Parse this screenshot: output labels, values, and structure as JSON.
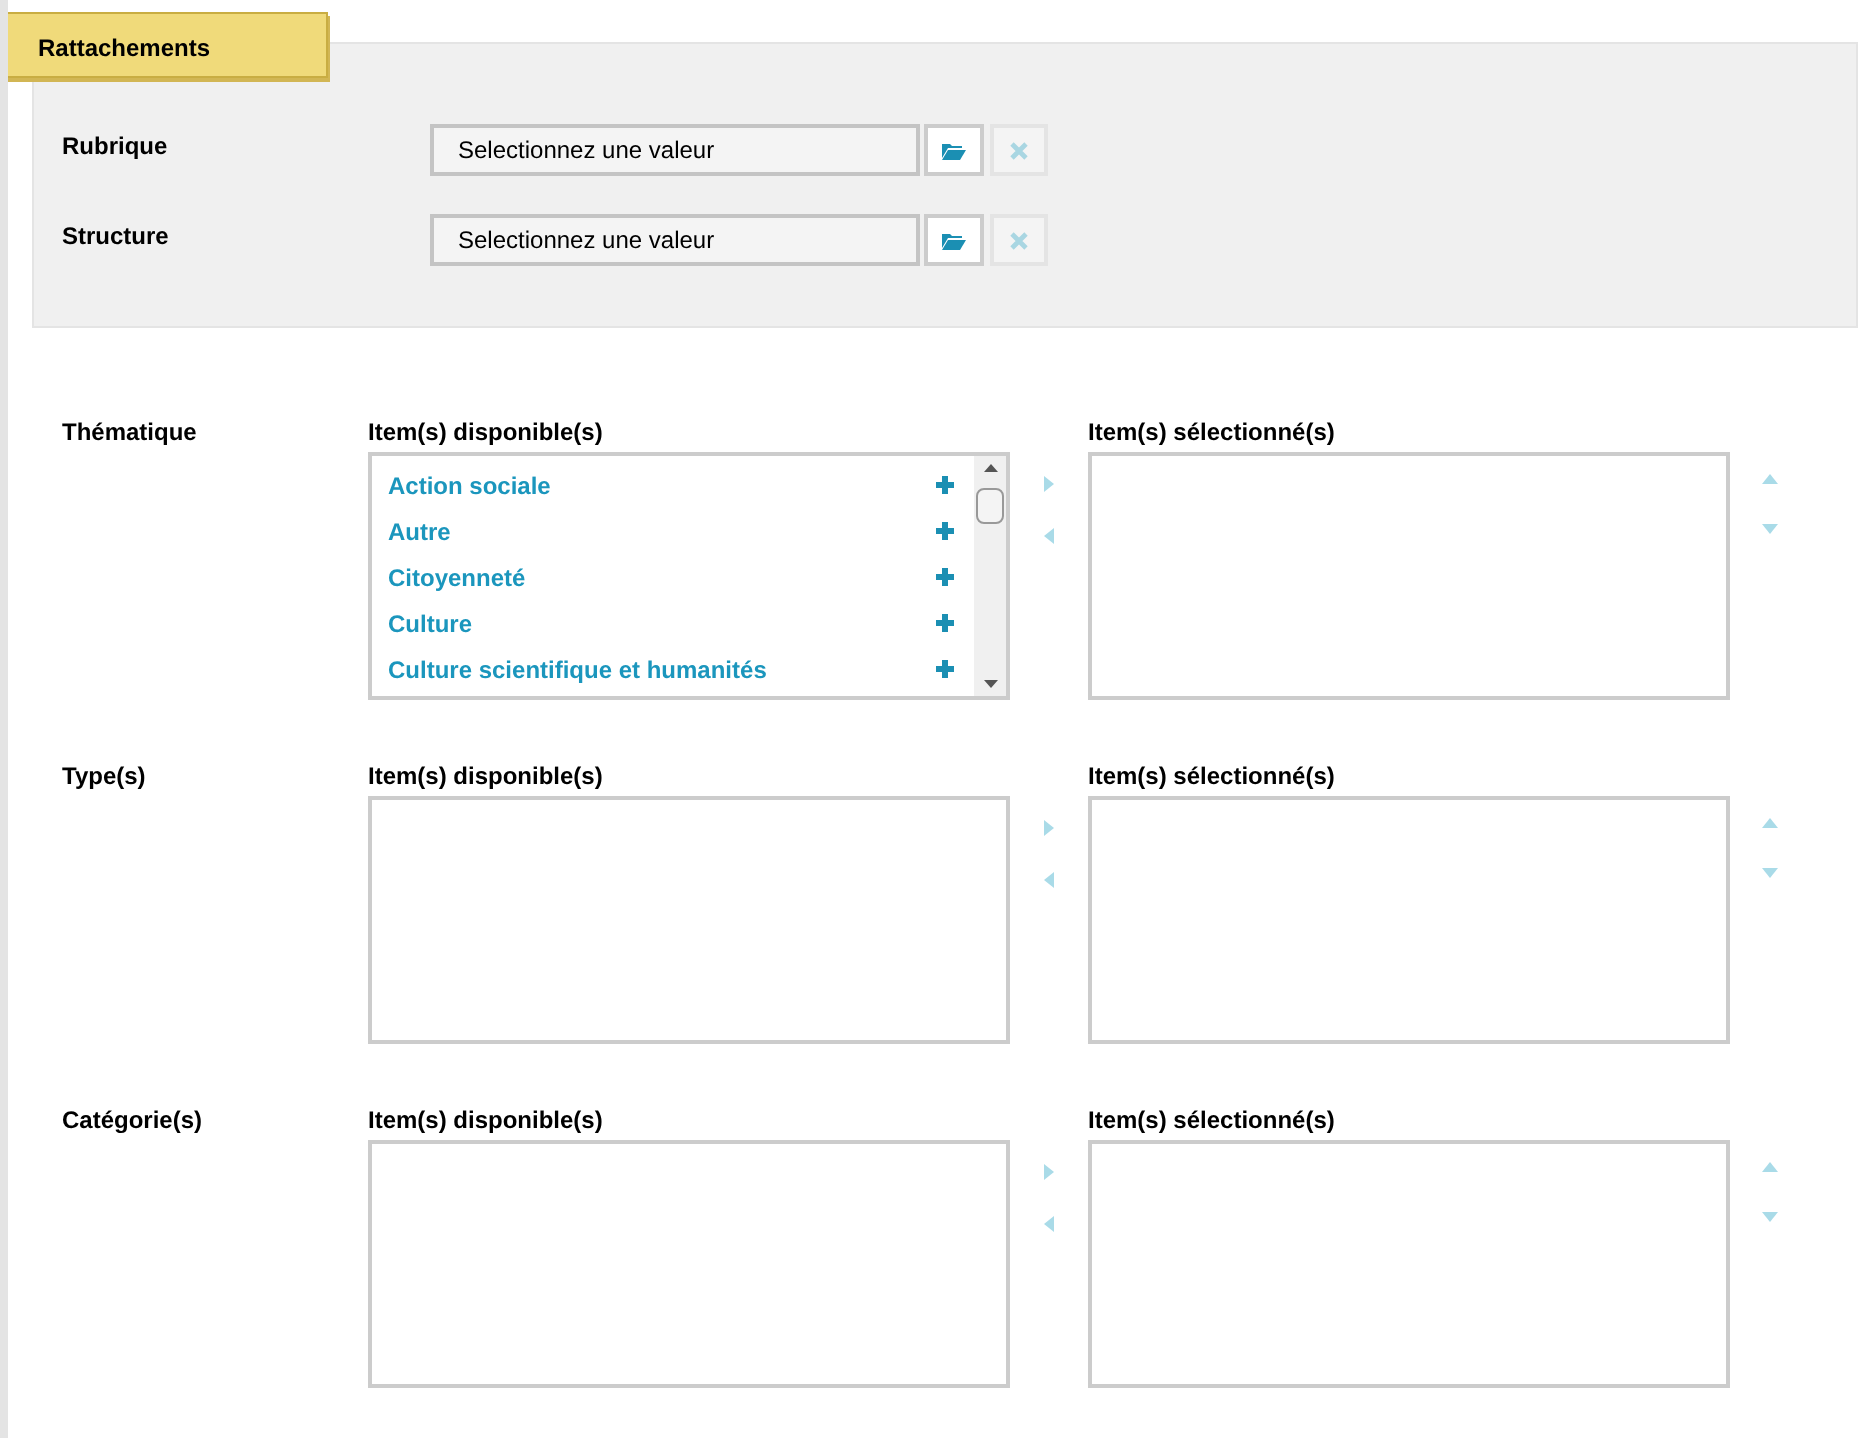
{
  "tab": {
    "label": "Rattachements"
  },
  "pickers": [
    {
      "label": "Rubrique",
      "placeholder": "Selectionnez une valeur"
    },
    {
      "label": "Structure",
      "placeholder": "Selectionnez une valeur"
    }
  ],
  "selectors": [
    {
      "label": "Thématique",
      "available_title": "Item(s) disponible(s)",
      "selected_title": "Item(s) sélectionné(s)",
      "available": [
        "Action sociale",
        "Autre",
        "Citoyenneté",
        "Culture",
        "Culture scientifique et humanités"
      ]
    },
    {
      "label": "Type(s)",
      "available_title": "Item(s) disponible(s)",
      "selected_title": "Item(s) sélectionné(s)"
    },
    {
      "label": "Catégorie(s)",
      "available_title": "Item(s) disponible(s)",
      "selected_title": "Item(s) sélectionné(s)"
    }
  ]
}
